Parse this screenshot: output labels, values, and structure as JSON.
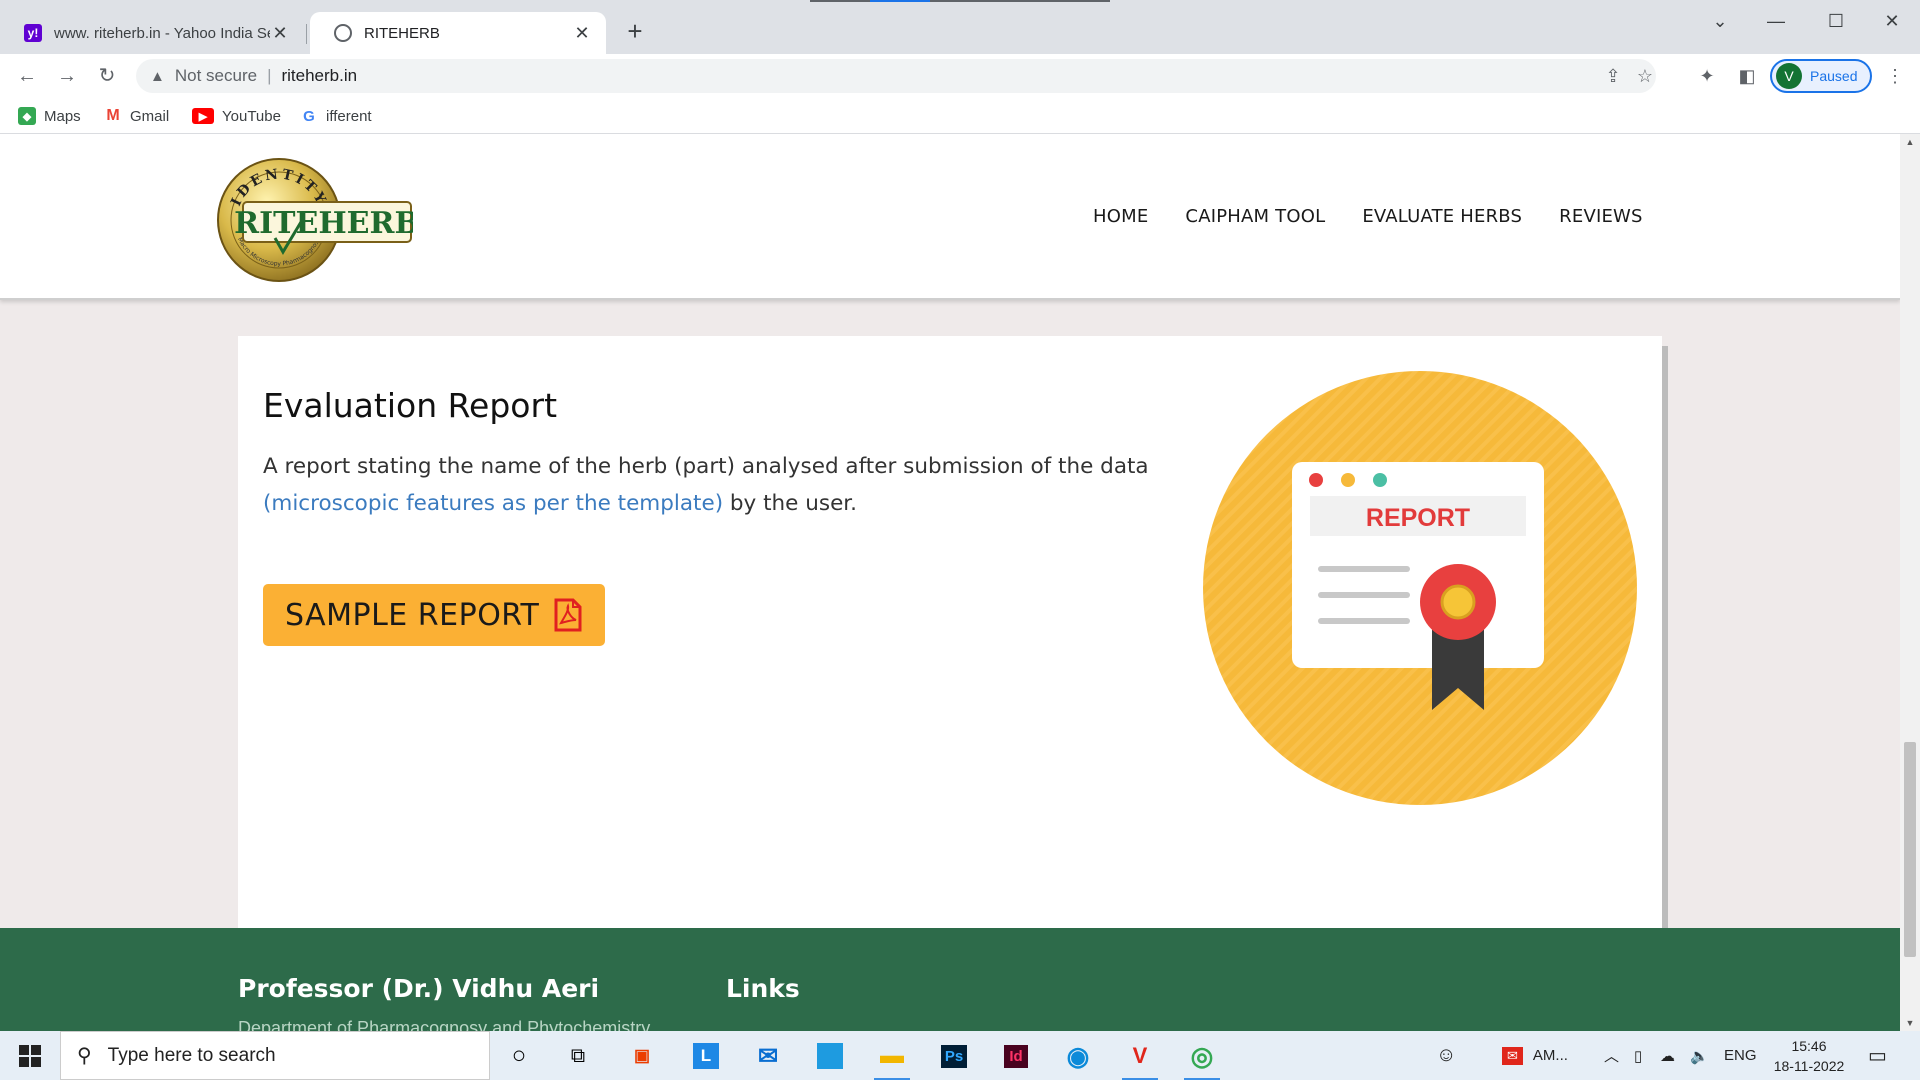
{
  "browser": {
    "tabs": [
      {
        "title": "www. riteherb.in - Yahoo India Se",
        "favicon": "yahoo-icon"
      },
      {
        "title": "RITEHERB",
        "favicon": "globe-icon"
      }
    ],
    "address": {
      "security_label": "Not secure",
      "url": "riteherb.in"
    },
    "profile": {
      "initial": "V",
      "status": "Paused"
    },
    "bookmarks": [
      {
        "label": "Maps",
        "icon": "maps-icon"
      },
      {
        "label": "Gmail",
        "icon": "gmail-icon"
      },
      {
        "label": "YouTube",
        "icon": "youtube-icon"
      },
      {
        "label": "ifferent",
        "icon": "google-icon"
      }
    ]
  },
  "site": {
    "logo_top": "IDENTITY",
    "logo_main": "RITEHERB",
    "logo_bottom": "Macro Microscopy Pharmacognosy",
    "nav": [
      "HOME",
      "CAIPHAM TOOL",
      "EVALUATE HERBS",
      "REVIEWS"
    ]
  },
  "section": {
    "title": "Evaluation Report",
    "description_before": "A report stating the name of the herb (part) analysed after submission of the data ",
    "description_link": "(microscopic features as per the template)",
    "description_after": " by the user.",
    "button_label": "SAMPLE REPORT",
    "illustration_label": "REPORT"
  },
  "footer": {
    "col1_title": "Professor (Dr.) Vidhu Aeri",
    "col2_title": "Links",
    "col1_sub": "Department of Pharmacognosy and Phytochemistry"
  },
  "taskbar": {
    "search_placeholder": "Type here to search",
    "tray_app": "AM...",
    "language": "ENG",
    "time": "15:46",
    "date": "18-11-2022"
  },
  "colors": {
    "accent_orange": "#fbb034",
    "footer_green": "#2d6b4a",
    "link_blue": "#3b7bbf"
  }
}
